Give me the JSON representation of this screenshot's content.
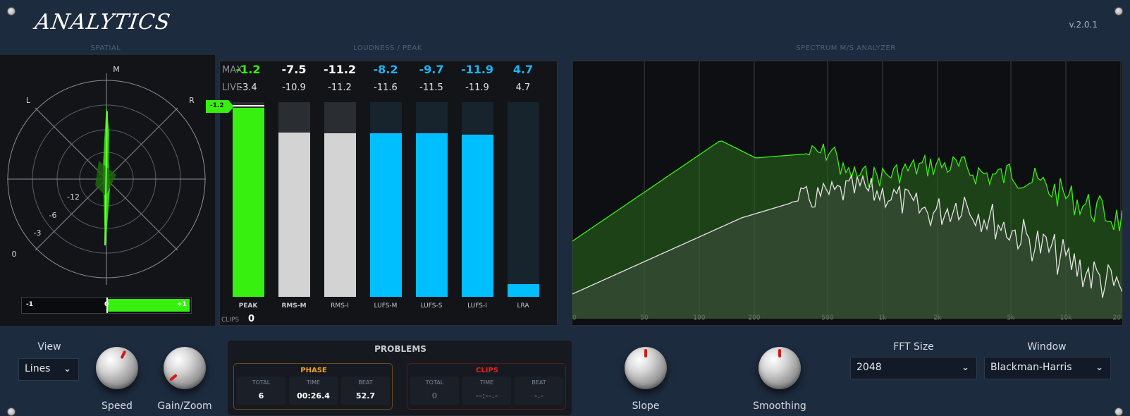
{
  "header": {
    "logo": "ANALYTICS",
    "version": "v.2.0.1"
  },
  "sections": {
    "spatial": "SPATIAL",
    "loudness": "LOUDNESS / PEAK",
    "spectrum": "SPECTRUM M/S ANALYZER"
  },
  "spatial": {
    "labels": {
      "m": "M",
      "l": "L",
      "r": "R"
    },
    "rings": [
      "-12",
      "-6",
      "-3",
      "0"
    ],
    "correlation": {
      "min": "-1",
      "mid": "0",
      "max": "+1",
      "value": 1.0
    }
  },
  "loudness": {
    "max_label": "MAX",
    "live_label": "LIVE",
    "clips_label": "CLIPS",
    "clips_value": "0",
    "peak_marker": "-1.2",
    "meters": [
      {
        "name": "PEAK",
        "max": "-1.2",
        "live": "-3.4",
        "level": 0.97,
        "color": "#38f010",
        "max_color": "#38f010",
        "bold": true
      },
      {
        "name": "RMS-M",
        "max": "-7.5",
        "live": "-10.9",
        "level": 0.845,
        "color": "#d3d3d3",
        "max_color": "#ffffff",
        "bold": true
      },
      {
        "name": "RMS-I",
        "max": "-11.2",
        "live": "-11.2",
        "level": 0.84,
        "color": "#d3d3d3",
        "max_color": "#ffffff",
        "bold": false
      },
      {
        "name": "LUFS-M",
        "max": "-8.2",
        "live": "-11.6",
        "level": 0.84,
        "color": "#00bfff",
        "max_color": "#1bb6f5",
        "bold": false
      },
      {
        "name": "LUFS-S",
        "max": "-9.7",
        "live": "-11.5",
        "level": 0.84,
        "color": "#00bfff",
        "max_color": "#1bb6f5",
        "bold": false
      },
      {
        "name": "LUFS-I",
        "max": "-11.9",
        "live": "-11.9",
        "level": 0.835,
        "color": "#00bfff",
        "max_color": "#1bb6f5",
        "bold": false
      },
      {
        "name": "LRA",
        "max": "4.7",
        "live": "4.7",
        "level": 0.065,
        "color": "#00bfff",
        "max_color": "#1bb6f5",
        "bold": false
      }
    ]
  },
  "spectrum": {
    "freq_labels": [
      "0",
      "50",
      "100",
      "200",
      "500",
      "1k",
      "2k",
      "5k",
      "10k",
      "20"
    ]
  },
  "controls": {
    "view_label": "View",
    "view_value": "Lines",
    "speed_label": "Speed",
    "gain_label": "Gain/Zoom",
    "slope_label": "Slope",
    "smoothing_label": "Smoothing",
    "fft_label": "FFT Size",
    "fft_value": "2048",
    "window_label": "Window",
    "window_value": "Blackman-Harris"
  },
  "problems": {
    "title": "PROBLEMS",
    "phase": {
      "title": "PHASE",
      "total_label": "TOTAL",
      "time_label": "TIME",
      "beat_label": "BEAT",
      "total": "6",
      "time": "00:26.4",
      "beat": "52.7"
    },
    "clips": {
      "title": "CLIPS",
      "total_label": "TOTAL",
      "time_label": "TIME",
      "beat_label": "BEAT",
      "total": "0",
      "time": "--:--.-",
      "beat": "-.-"
    }
  },
  "colors": {
    "green": "#38f010",
    "blue": "#00bfff",
    "phase_orange": "#f0a020",
    "clips_red": "#e02020",
    "bg": "#1d2b3e"
  }
}
